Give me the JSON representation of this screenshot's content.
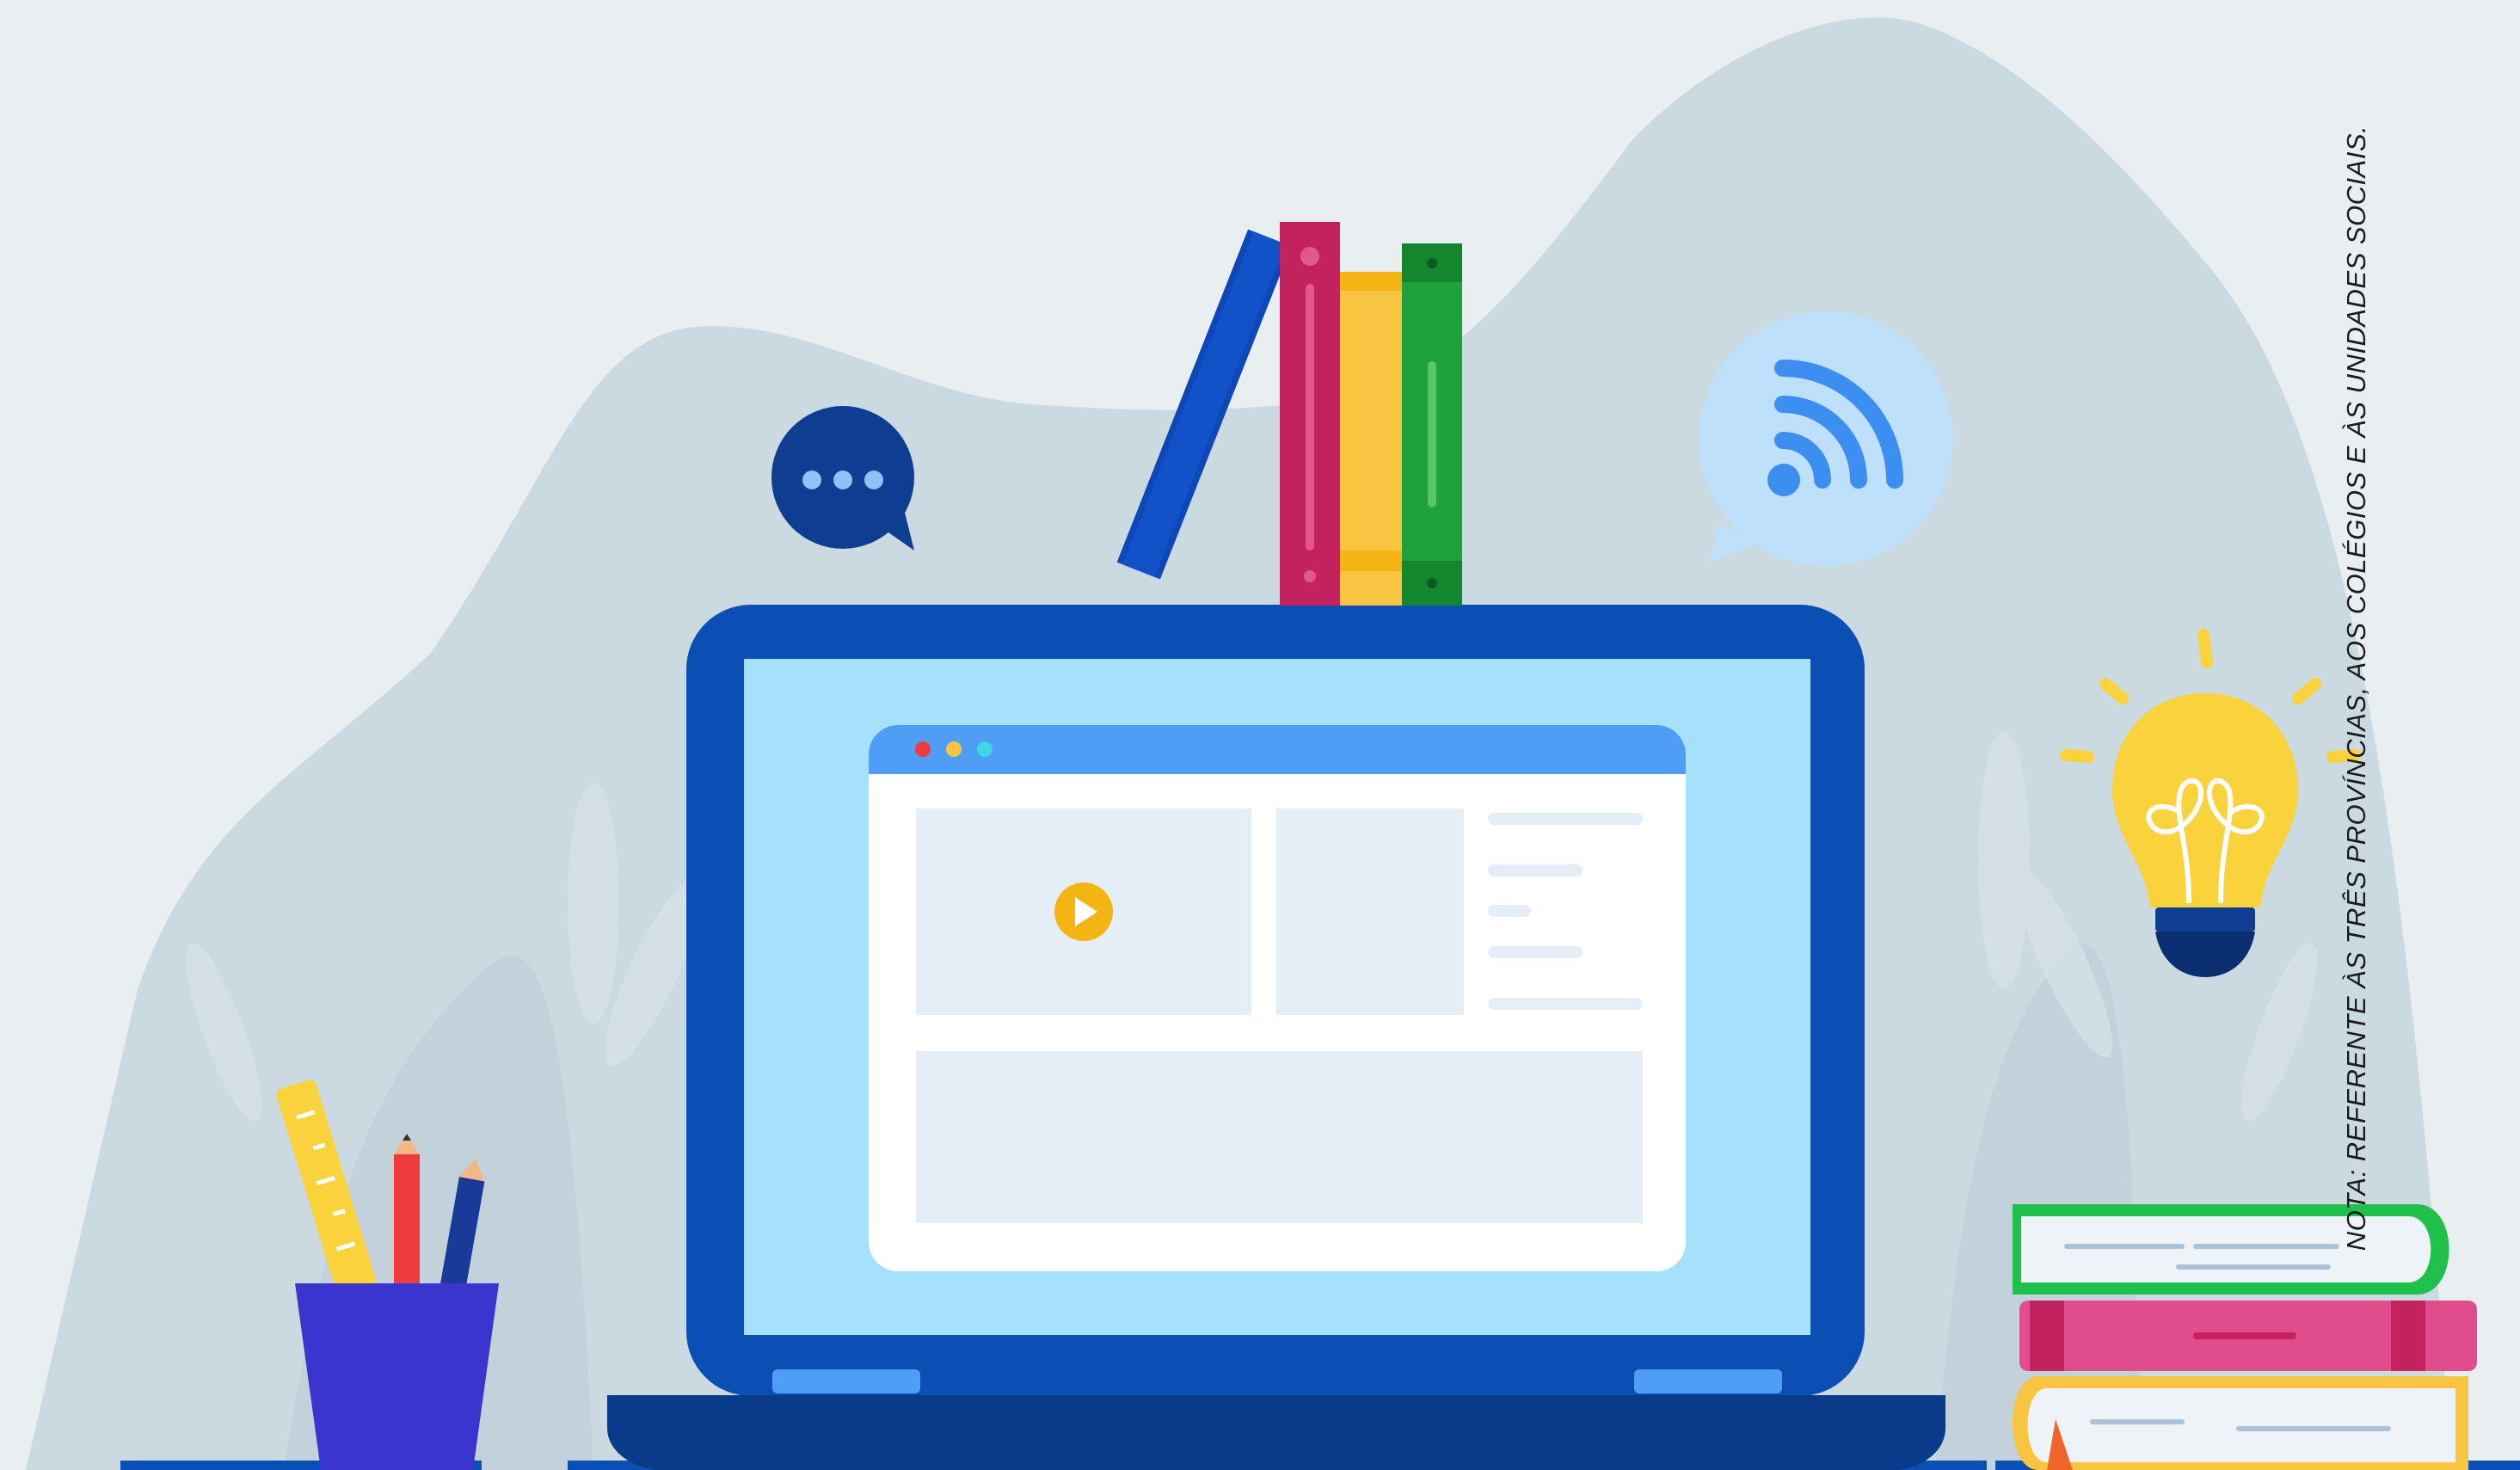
{
  "note": {
    "text": "NOTA: REFERENTE ÀS TRÊS PROVÍNCIAS, AOS COLÉGIOS E ÀS UNIDADES SOCIAIS."
  },
  "colors": {
    "background": "#e9eef1",
    "backdrop_hill": "#cbd9e0",
    "laptop_frame": "#0b4fb5",
    "laptop_screen": "#a5e1fb",
    "browser_bar": "#4f9df5",
    "book_blue": "#0d47b8",
    "book_magenta": "#c2225d",
    "book_yellow": "#f7c542",
    "book_green": "#1fa23c",
    "chat_bubble": "#0e3d91",
    "wifi_bubble": "#bfe0fb",
    "wifi_icon": "#3c8ef1",
    "bulb": "#fad23c",
    "pen_cup": "#3b35cf",
    "play_button": "#f4b414"
  },
  "icons": [
    "chat-bubble-icon",
    "wifi-signal-icon",
    "light-bulb-icon",
    "play-icon",
    "book-stack-icon",
    "pencil-cup-icon",
    "laptop-icon"
  ]
}
